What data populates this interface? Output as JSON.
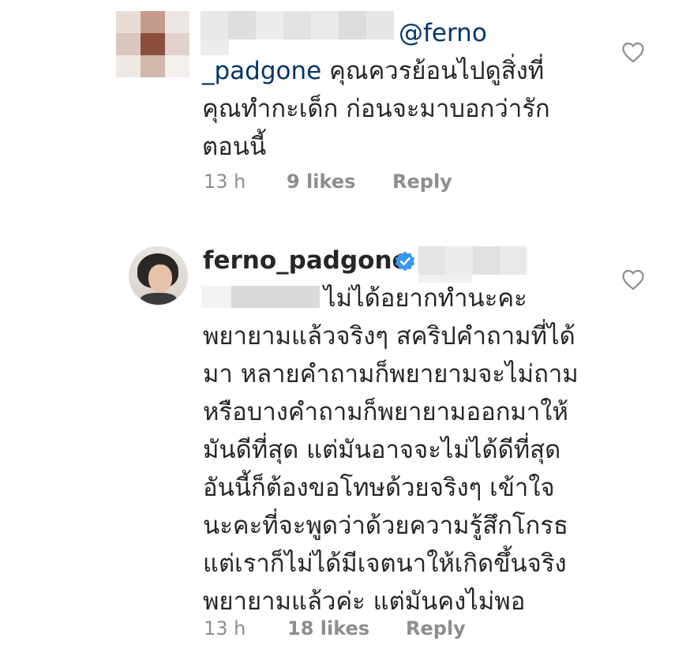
{
  "comments": [
    {
      "mention": "@ferno",
      "lines": [
        "_padgone คุณควรย้อนไปดูสิ่งที่",
        "คุณทำกะเด็ก ก่อนจะมาบอกว่ารัก",
        "ตอนนี้"
      ],
      "mention_cont": "_padgone",
      "line1_rest": " คุณควรย้อนไปดูสิ่งที่",
      "time": "13 h",
      "likes": "9 likes",
      "reply": "Reply",
      "avatar_icon": "pixelated-avatar-icon"
    },
    {
      "username": "ferno_padgone",
      "verified_icon": "verified-badge-icon",
      "lines": [
        "ไม่ได้อยากทำนะคะ",
        "พยายามแล้วจริงๆ สคริปคำถามที่ได้",
        "มา หลายคำถามก็พยายามจะไม่ถาม",
        "หรือบางคำถามก็พยายามออกมาให้",
        "มันดีที่สุด แต่มันอาจจะไม่ได้ดีที่สุด",
        "อันนี้ก็ต้องขอโทษด้วยจริงๆ เข้าใจ",
        "นะคะที่จะพูดว่าด้วยความรู้สึกโกรธ",
        "แต่เราก็ไม่ได้มีเจตนาให้เกิดขึ้นจริง",
        "พยายามแล้วค่ะ แต่มันคงไม่พอ"
      ],
      "time": "13 h",
      "likes": "18 likes",
      "reply": "Reply"
    }
  ],
  "colors": {
    "text": "#262626",
    "meta": "#8e8e8e",
    "mention": "#003569",
    "verified": "#3897f0"
  }
}
